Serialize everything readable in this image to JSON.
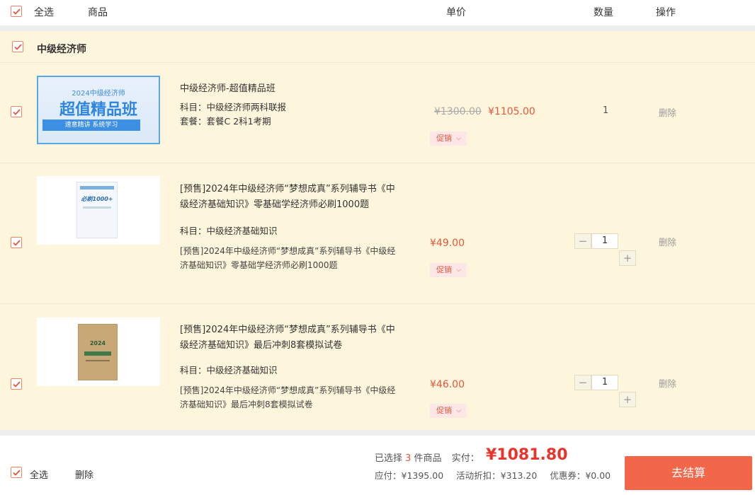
{
  "header": {
    "select_all": "全选",
    "col_product": "商品",
    "col_price": "单价",
    "col_qty": "数量",
    "col_action": "操作"
  },
  "group": {
    "title": "中级经济师"
  },
  "items": [
    {
      "title": "中级经济师-超值精品班",
      "subject": "科目：中级经济师两科联报",
      "package": "套餐：套餐C 2科1考期",
      "old_price": "¥1300.00",
      "price": "¥1105.00",
      "promo": "促销",
      "qty": "1",
      "delete": "删除",
      "cover_small": "2024中级经济师",
      "cover_big": "超值精品班",
      "cover_band": "速意精讲 系统学习"
    },
    {
      "title": "[预售]2024年中级经济师“梦想成真”系列辅导书《中级经济基础知识》零基础学经济师必刷1000题",
      "subject": "科目：中级经济基础知识",
      "desc": "[预售]2024年中级经济师“梦想成真”系列辅导书《中级经济基础知识》零基础学经济师必刷1000题",
      "price": "¥49.00",
      "promo": "促销",
      "qty": "1",
      "minus": "−",
      "plus": "+",
      "delete": "删除",
      "cover_text": "必刷1000+"
    },
    {
      "title": "[预售]2024年中级经济师“梦想成真”系列辅导书《中级经济基础知识》最后冲刺8套模拟试卷",
      "subject": "科目：中级经济基础知识",
      "desc": "[预售]2024年中级经济师“梦想成真”系列辅导书《中级经济基础知识》最后冲刺8套模拟试卷",
      "price": "¥46.00",
      "promo": "促销",
      "qty": "1",
      "minus": "−",
      "plus": "+",
      "delete": "删除",
      "cover_text": "2024"
    }
  ],
  "footer": {
    "select_all": "全选",
    "delete": "删除",
    "selected_prefix": "已选择 ",
    "selected_count": "3",
    "selected_suffix": " 件商品",
    "paid_label": "实付：",
    "paid_value": "¥1081.80",
    "payable": "应付：¥1395.00",
    "discount": "活动折扣：¥313.20",
    "coupon": "优惠券：¥0.00",
    "checkout": "去结算"
  },
  "colors": {
    "accent": "#f2674a",
    "price": "#e8553a",
    "group_bg": "#fdf6dc"
  }
}
